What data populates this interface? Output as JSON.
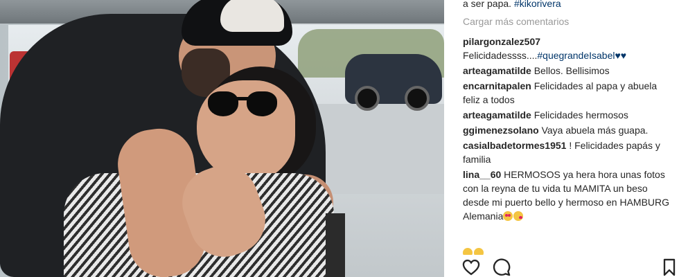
{
  "post": {
    "caption_tail": "a ser papa.",
    "caption_hashtag": "#kikorivera",
    "load_more_label": "Cargar más comentarios"
  },
  "comments": [
    {
      "user": "pilargonzalez507",
      "text": "Felicidadessss....",
      "hashtag": "#quegrandeIsabel",
      "suffix": "♥♥"
    },
    {
      "user": "arteagamatilde",
      "text": "Bellos. Bellisimos"
    },
    {
      "user": "encarnitapalen",
      "text": "Felicidades al papa y abuela feliz a todos"
    },
    {
      "user": "arteagamatilde",
      "text": "Felicidades hermosos"
    },
    {
      "user": "ggimenezsolano",
      "text": "Vaya abuela más guapa."
    },
    {
      "user": "casialbadetormes1951",
      "text": "! Felicidades papás y familia"
    },
    {
      "user": "lina__60",
      "text": "HERMOSOS ya hera hora unas fotos con la reyna de tu vida tu MAMITA un beso desde mi puerto bello y hermoso en HAMBURG Alemania"
    }
  ],
  "icons": {
    "like": "heart-icon",
    "comment": "comment-icon",
    "save": "bookmark-icon"
  },
  "colors": {
    "hashtag": "#003569",
    "muted": "#999999",
    "text": "#262626"
  }
}
